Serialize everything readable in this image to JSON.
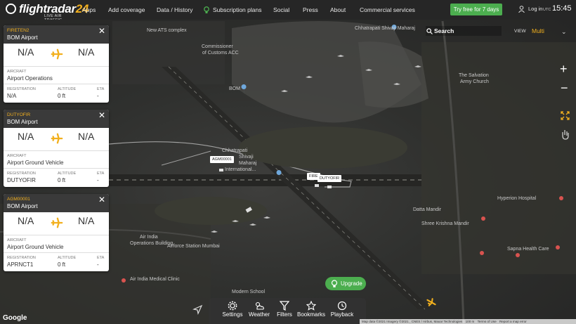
{
  "header": {
    "logo_text": "flightradar",
    "logo_num": "24",
    "logo_sub": "LIVE AIR TRAFFIC",
    "nav": [
      "Apps",
      "Add coverage",
      "Data / History",
      "Subscription plans",
      "Social",
      "Press",
      "About",
      "Commercial services"
    ],
    "try_label": "Try free for 7 days",
    "login_label": "Log in",
    "utc_label": "UTC",
    "time": "15:45"
  },
  "panels": [
    {
      "callsign": "FIRETEN2",
      "airport": "BOM Airport",
      "origin": "N/A",
      "destination": "N/A",
      "aircraft_label": "AIRCRAFT",
      "aircraft": "Airport Operations",
      "reg_label": "REGISTRATION",
      "registration": "N/A",
      "alt_label": "ALTITUDE",
      "altitude": "0 ft",
      "eta_label": "ETA",
      "eta": "-"
    },
    {
      "callsign": "DUTYOFIR",
      "airport": "BOM Airport",
      "origin": "N/A",
      "destination": "N/A",
      "aircraft_label": "AIRCRAFT",
      "aircraft": "Airport Ground Vehicle",
      "reg_label": "REGISTRATION",
      "registration": "DUTYOFIR",
      "alt_label": "ALTITUDE",
      "altitude": "0 ft",
      "eta_label": "ETA",
      "eta": "-"
    },
    {
      "callsign": "AGM00001",
      "airport": "BOM Airport",
      "origin": "N/A",
      "destination": "N/A",
      "aircraft_label": "AIRCRAFT",
      "aircraft": "Airport Ground Vehicle",
      "reg_label": "REGISTRATION",
      "registration": "APRNCT1",
      "alt_label": "ALTITUDE",
      "altitude": "0 ft",
      "eta_label": "ETA",
      "eta": "-"
    }
  ],
  "map": {
    "search_label": "Search",
    "view_label": "VIEW",
    "view_value": "Multi",
    "labels": {
      "l1": "New ATS complex",
      "l2": "Commissioner",
      "l3": "of Customs ACC",
      "l4": "BOM",
      "l5": "Chhatrapati",
      "l6": "Shivaji",
      "l7": "Maharaj",
      "l8": "International...",
      "l9": "The Salvation",
      "l10": "Army Church",
      "l11": "Datta Mandir",
      "l12": "Airforce Station Mumbai",
      "l13": "Air India",
      "l14": "Operations Building",
      "l15": "Air India Medical Clinic",
      "l16": "Modern School",
      "l17": "Sapna Health Care",
      "l18": "Shree Krishna Mandir",
      "l19": "Hyperion Hospital",
      "l20": "Chhatrapati Shivaji Maharaj"
    },
    "vehicle_labels": [
      "AGM00001",
      "FIRE",
      "DUTYOFIR"
    ]
  },
  "bottom": {
    "items": [
      "Settings",
      "Weather",
      "Filters",
      "Bookmarks",
      "Playback"
    ],
    "upgrade": "Upgrade",
    "google": "Google",
    "attribution": [
      "Map data ©2021 Imagery ©2021 , CNES / Airbus, Maxar Technologies",
      "100 m",
      "Terms of Use",
      "Report a map error"
    ]
  },
  "colors": {
    "accent": "#f2b01e",
    "green": "#4cae4f",
    "bar": "#262626"
  }
}
